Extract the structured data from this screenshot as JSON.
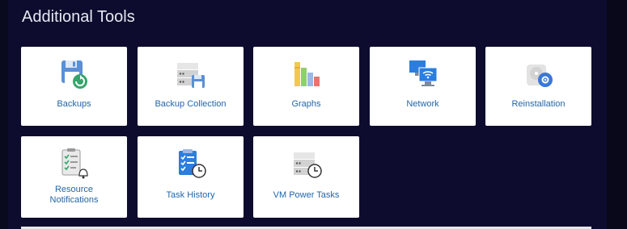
{
  "section": {
    "title": "Additional Tools"
  },
  "tools": [
    {
      "label": "Backups",
      "icon": "backup-floppy-icon"
    },
    {
      "label": "Backup Collection",
      "icon": "server-floppy-icon"
    },
    {
      "label": "Graphs",
      "icon": "bar-graph-icon"
    },
    {
      "label": "Network",
      "icon": "network-monitors-icon"
    },
    {
      "label": "Reinstallation",
      "icon": "disk-gear-icon"
    },
    {
      "label_line1": "Resource",
      "label_line2": "Notifications",
      "icon": "clipboard-bell-icon"
    },
    {
      "label": "Task History",
      "icon": "clipboard-clock-icon"
    },
    {
      "label": "VM Power Tasks",
      "icon": "server-clock-icon"
    }
  ]
}
